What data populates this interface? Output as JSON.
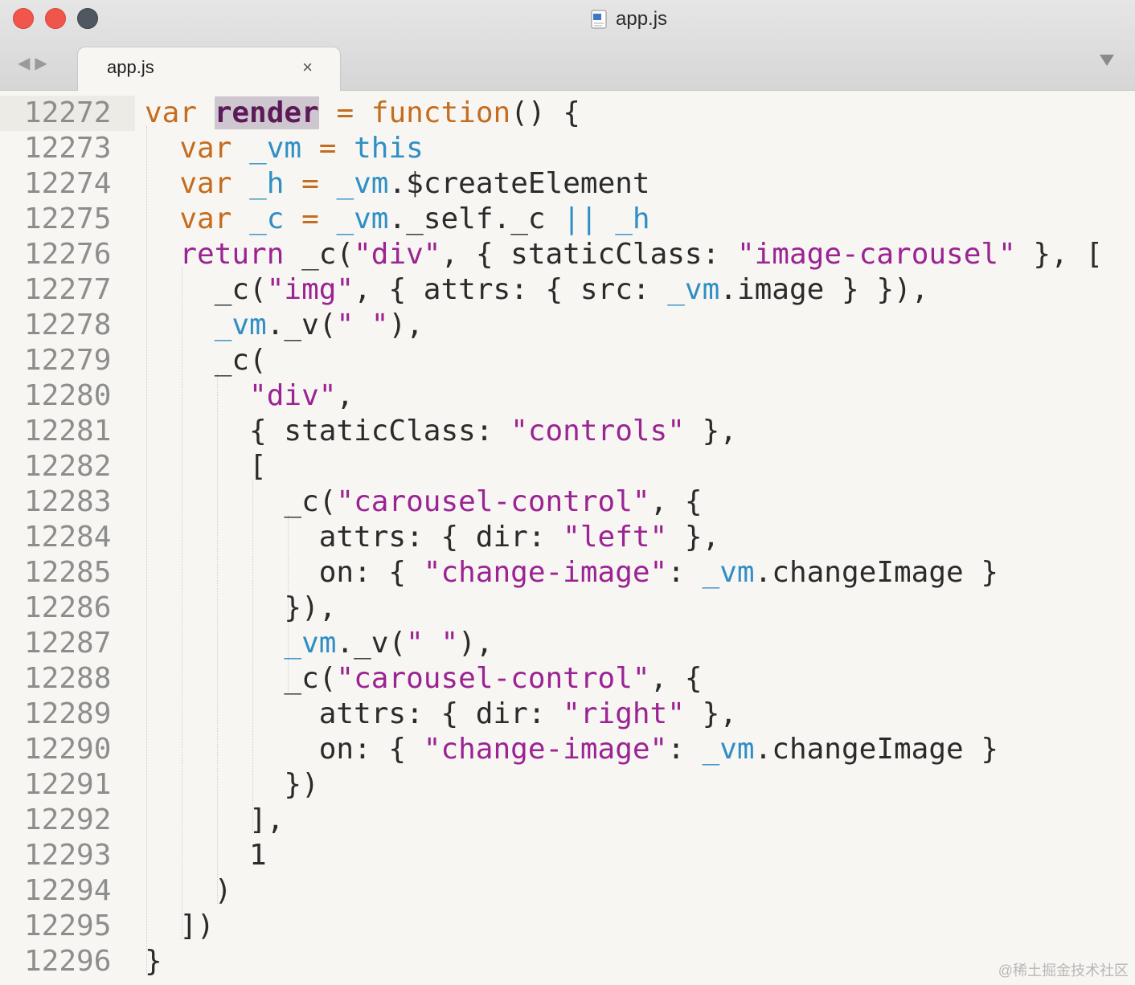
{
  "window": {
    "title": "app.js"
  },
  "tabs": [
    {
      "label": "app.js",
      "close": "×"
    }
  ],
  "nav": {
    "back": "◀",
    "forward": "▶"
  },
  "editor": {
    "lines": [
      {
        "num": "12272",
        "parts": [
          [
            "kw",
            "var "
          ],
          [
            "hl",
            "render"
          ],
          [
            "",
            " "
          ],
          [
            "kw",
            "= function"
          ],
          [
            "",
            "() {"
          ]
        ]
      },
      {
        "num": "12273",
        "parts": [
          [
            "",
            "  "
          ],
          [
            "kw",
            "var "
          ],
          [
            "vm",
            "_vm"
          ],
          [
            "kw",
            " = "
          ],
          [
            "vm",
            "this"
          ]
        ]
      },
      {
        "num": "12274",
        "parts": [
          [
            "",
            "  "
          ],
          [
            "kw",
            "var "
          ],
          [
            "vm",
            "_h"
          ],
          [
            "kw",
            " = "
          ],
          [
            "vm",
            "_vm"
          ],
          [
            "",
            ".$createElement"
          ]
        ]
      },
      {
        "num": "12275",
        "parts": [
          [
            "",
            "  "
          ],
          [
            "kw",
            "var "
          ],
          [
            "vm",
            "_c"
          ],
          [
            "kw",
            " = "
          ],
          [
            "vm",
            "_vm"
          ],
          [
            "",
            "._self._c "
          ],
          [
            "vm",
            "|| _h"
          ]
        ]
      },
      {
        "num": "12276",
        "parts": [
          [
            "",
            "  "
          ],
          [
            "kw2",
            "return "
          ],
          [
            "",
            "_c("
          ],
          [
            "str",
            "\"div\""
          ],
          [
            "",
            ", { staticClass: "
          ],
          [
            "str",
            "\"image-carousel\""
          ],
          [
            "",
            " }, ["
          ]
        ]
      },
      {
        "num": "12277",
        "parts": [
          [
            "",
            "    _c("
          ],
          [
            "str",
            "\"img\""
          ],
          [
            "",
            ", { attrs: { src: "
          ],
          [
            "vm",
            "_vm"
          ],
          [
            "",
            ".image } }),"
          ]
        ]
      },
      {
        "num": "12278",
        "parts": [
          [
            "",
            "    "
          ],
          [
            "vm",
            "_vm"
          ],
          [
            "",
            "._v("
          ],
          [
            "str",
            "\" \""
          ],
          [
            "",
            "),"
          ]
        ]
      },
      {
        "num": "12279",
        "parts": [
          [
            "",
            "    _c("
          ]
        ]
      },
      {
        "num": "12280",
        "parts": [
          [
            "",
            "      "
          ],
          [
            "str",
            "\"div\""
          ],
          [
            "",
            ","
          ]
        ]
      },
      {
        "num": "12281",
        "parts": [
          [
            "",
            "      { staticClass: "
          ],
          [
            "str",
            "\"controls\""
          ],
          [
            "",
            " },"
          ]
        ]
      },
      {
        "num": "12282",
        "parts": [
          [
            "",
            "      ["
          ]
        ]
      },
      {
        "num": "12283",
        "parts": [
          [
            "",
            "        _c("
          ],
          [
            "str",
            "\"carousel-control\""
          ],
          [
            "",
            ", {"
          ]
        ]
      },
      {
        "num": "12284",
        "parts": [
          [
            "",
            "          attrs: { dir: "
          ],
          [
            "str",
            "\"left\""
          ],
          [
            "",
            " },"
          ]
        ]
      },
      {
        "num": "12285",
        "parts": [
          [
            "",
            "          on: { "
          ],
          [
            "str",
            "\"change-image\""
          ],
          [
            "",
            ": "
          ],
          [
            "vm",
            "_vm"
          ],
          [
            "",
            ".changeImage }"
          ]
        ]
      },
      {
        "num": "12286",
        "parts": [
          [
            "",
            "        }),"
          ]
        ]
      },
      {
        "num": "12287",
        "parts": [
          [
            "",
            "        "
          ],
          [
            "vm",
            "_vm"
          ],
          [
            "",
            "._v("
          ],
          [
            "str",
            "\" \""
          ],
          [
            "",
            "),"
          ]
        ]
      },
      {
        "num": "12288",
        "parts": [
          [
            "",
            "        _c("
          ],
          [
            "str",
            "\"carousel-control\""
          ],
          [
            "",
            ", {"
          ]
        ]
      },
      {
        "num": "12289",
        "parts": [
          [
            "",
            "          attrs: { dir: "
          ],
          [
            "str",
            "\"right\""
          ],
          [
            "",
            " },"
          ]
        ]
      },
      {
        "num": "12290",
        "parts": [
          [
            "",
            "          on: { "
          ],
          [
            "str",
            "\"change-image\""
          ],
          [
            "",
            ": "
          ],
          [
            "vm",
            "_vm"
          ],
          [
            "",
            ".changeImage }"
          ]
        ]
      },
      {
        "num": "12291",
        "parts": [
          [
            "",
            "        })"
          ]
        ]
      },
      {
        "num": "12292",
        "parts": [
          [
            "",
            "      ],"
          ]
        ]
      },
      {
        "num": "12293",
        "parts": [
          [
            "",
            "      1"
          ]
        ]
      },
      {
        "num": "12294",
        "parts": [
          [
            "",
            "    )"
          ]
        ]
      },
      {
        "num": "12295",
        "parts": [
          [
            "",
            "  ])"
          ]
        ]
      },
      {
        "num": "12296",
        "parts": [
          [
            "",
            "}"
          ]
        ]
      }
    ]
  },
  "watermark": "@稀土掘金技术社区"
}
